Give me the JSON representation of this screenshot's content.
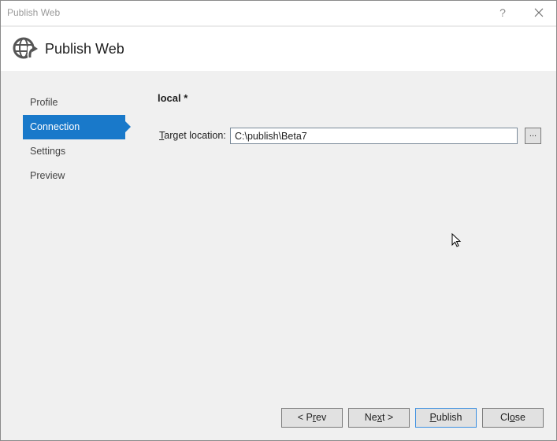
{
  "window": {
    "title": "Publish Web",
    "help_label": "?",
    "close_icon": "close-icon"
  },
  "header": {
    "icon": "globe-publish-icon",
    "title": "Publish Web"
  },
  "sidebar": {
    "items": [
      {
        "label": "Profile",
        "active": false
      },
      {
        "label": "Connection",
        "active": true
      },
      {
        "label": "Settings",
        "active": false
      },
      {
        "label": "Preview",
        "active": false
      }
    ]
  },
  "main": {
    "profile_name": "local *",
    "target_location": {
      "label_access_key": "T",
      "label_rest": "arget location:",
      "value": "C:\\publish\\Beta7",
      "browse_label": "..."
    }
  },
  "footer": {
    "buttons": [
      {
        "pre": "< P",
        "key": "r",
        "post": "ev"
      },
      {
        "pre": "Ne",
        "key": "x",
        "post": "t >"
      },
      {
        "pre": "",
        "key": "P",
        "post": "ublish"
      },
      {
        "pre": "Cl",
        "key": "o",
        "post": "se"
      }
    ]
  },
  "colors": {
    "accent": "#1979ca",
    "default_button_border": "#3c8fe0"
  }
}
